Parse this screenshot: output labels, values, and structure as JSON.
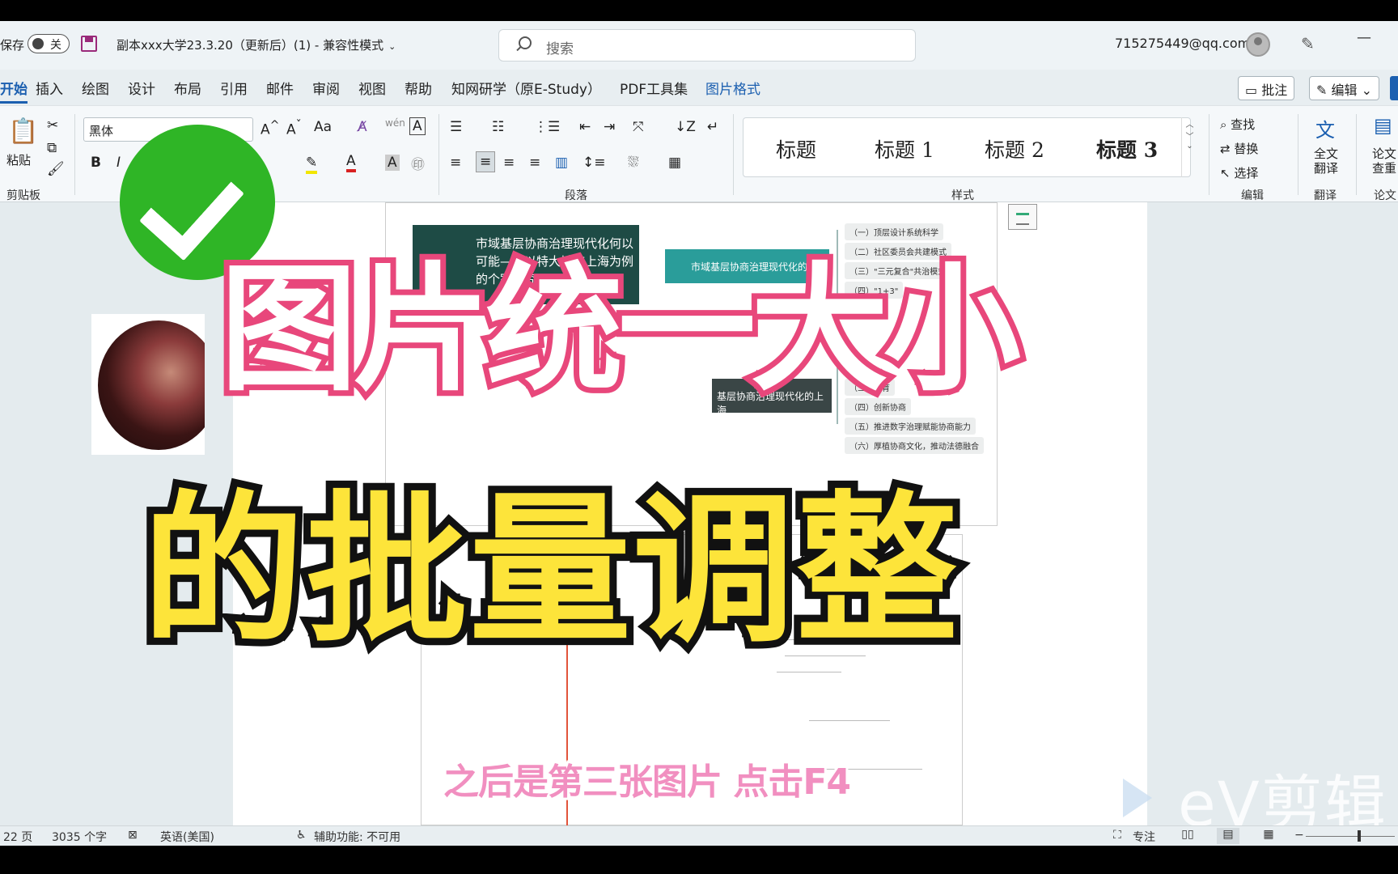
{
  "titlebar": {
    "autosave_label": "保存",
    "autosave_state": "关",
    "document_title": "副本xxx大学23.3.20（更新后）(1) - 兼容性模式",
    "search_placeholder": "搜索",
    "account": "715275449@qq.com",
    "minimize_glyph": "—"
  },
  "tabs": [
    "开始",
    "插入",
    "绘图",
    "设计",
    "布局",
    "引用",
    "邮件",
    "审阅",
    "视图",
    "帮助",
    "知网研学（原E-Study）",
    "PDF工具集",
    "图片格式"
  ],
  "tab_actions": {
    "comment": "批注",
    "edit": "编辑"
  },
  "ribbon": {
    "clipboard": {
      "paste": "粘贴",
      "label": "剪贴板"
    },
    "font": {
      "name": "黑体",
      "bold": "B",
      "italic": "I",
      "size_up": "A^",
      "size_down": "Aˇ",
      "case": "Aa",
      "font_color": "A"
    },
    "paragraph": {
      "label": "段落"
    },
    "styles": {
      "label": "样式",
      "items": [
        "标题",
        "标题 1",
        "标题 2",
        "标题 3"
      ]
    },
    "editing": {
      "find": "查找",
      "replace": "替换",
      "select": "选择",
      "label": "编辑"
    },
    "translate": {
      "full": "全文翻译",
      "label": "翻译"
    },
    "paper": {
      "check": "论文查重",
      "label": "论文"
    }
  },
  "document": {
    "mindmap_title": "市域基层协商治理现代化何以可能——以特大城市上海为例的个案研究",
    "root_node": "市域基层协商治理现代化的上海",
    "second_node": "基层协商治理现代化的上海",
    "leaves_top": [
      "（一）顶层设计系统科学",
      "（二）社区委员会共建模式",
      "（三）\"三元复合\"共治模式",
      "（四）\"1+3\""
    ],
    "leaves_bottom": [
      "（三）培育",
      "（四）创新协商",
      "（五）推进数字治理赋能协商能力",
      "（六）厚植协商文化，推动法德融合"
    ]
  },
  "overlay": {
    "headline_1": "图片统一大小",
    "headline_2": "的批量调整",
    "subtitle": "之后是第三张图片 点击F4",
    "watermark": "eV剪辑"
  },
  "statusbar": {
    "page": "22 页",
    "words": "3035 个字",
    "language": "英语(美国)",
    "accessibility": "辅助功能: 不可用",
    "focus": "专注"
  },
  "colors": {
    "accent": "#1b5fb0",
    "headline_1_stroke": "#e8477b",
    "headline_2_fill": "#fde43a",
    "check": "#2fb526"
  }
}
